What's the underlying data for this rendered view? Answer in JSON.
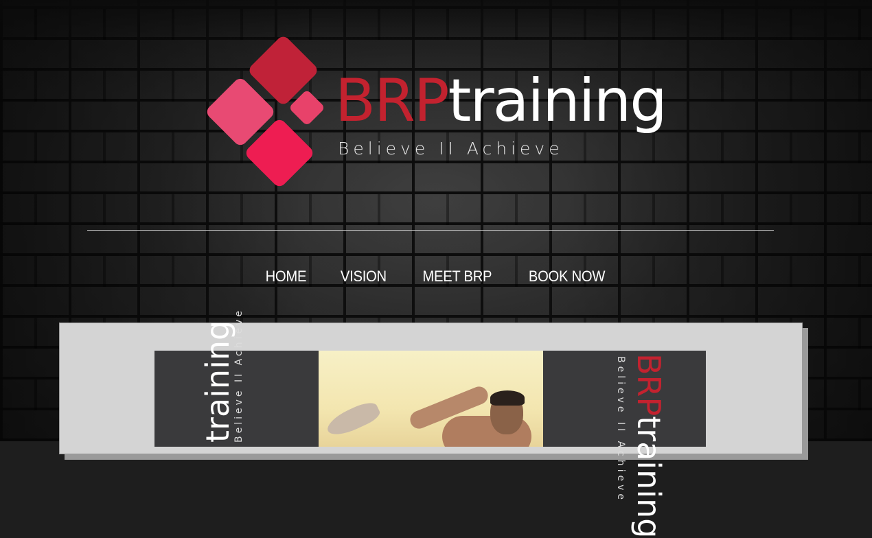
{
  "logo": {
    "brand_red": "BRP",
    "brand_white": "training",
    "tagline": "Believe II Achieve",
    "colors": {
      "red": "#c3222f",
      "pink": "#e84a73",
      "crimson": "#ee1d52"
    }
  },
  "nav": {
    "items": [
      {
        "label": "HOME"
      },
      {
        "label": "VISION"
      },
      {
        "label": "MEET BRP"
      },
      {
        "label": "BOOK NOW"
      }
    ]
  },
  "banner": {
    "left_text": "training",
    "left_tagline": "Believe II Achieve",
    "right_brand_red": "BRP",
    "right_brand_white": "training",
    "right_tagline": "Believe II Achieve"
  }
}
